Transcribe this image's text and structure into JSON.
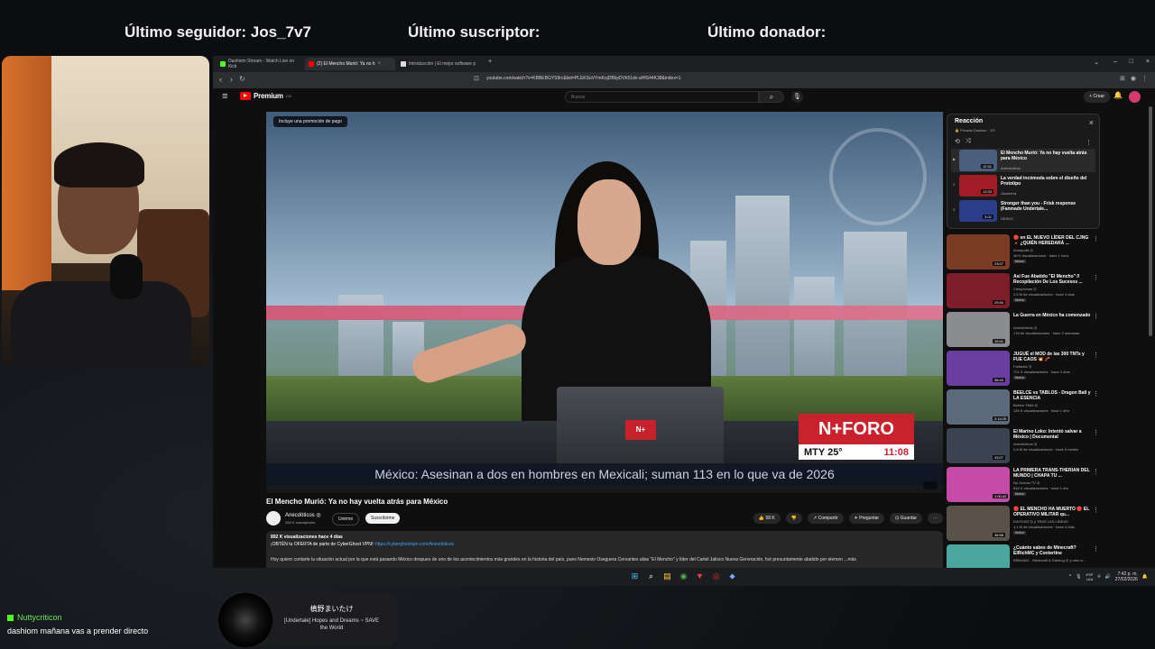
{
  "stream_bar": {
    "follower": "Último seguidor: Jos_7v7",
    "subscriber": "Último suscriptor:",
    "donor": "Último donador:"
  },
  "browser": {
    "tabs": [
      {
        "label": "Dashiom Stream - Watch Live on Kick",
        "active": false
      },
      {
        "label": "(2) El Mencho Murió: Ya no h",
        "active": true
      },
      {
        "label": "Introducción | El mejor software p",
        "active": false
      }
    ],
    "url": "youtube.com/watch?v=KBBEBGYS9rc&list=PLEKSoVYmKojDBbyDVk51dv-aHfS44K38&index=1"
  },
  "youtube": {
    "logo_text": "Premium",
    "logo_region": "CO",
    "search_placeholder": "Buscar",
    "create_label": "+ Crear",
    "video": {
      "promo_label": "Incluye una promoción de pago",
      "logo": "N+FORO",
      "city": "MTY 25°",
      "time": "11:08",
      "ticker": "México: Asesinan a dos en hombres en Mexicali; suman 113 en lo que va de 2026",
      "laptop_logo": "N+"
    },
    "title": "El Mencho Murió: Ya no hay vuelta atrás para México",
    "channel": {
      "name": "Anecdóticos ◎",
      "subs": "268 K suscriptores"
    },
    "join_label": "Unirme",
    "subscribe_label": "Suscribirme",
    "actions": [
      "👍 58 K",
      "👎",
      "↗ Compartir",
      "✦ Preguntar",
      "⊡ Guardar",
      "···"
    ],
    "description": {
      "stats": "892 K visualizaciones  hace 4 días",
      "promo_text": "¡OBTÉN tu OFERTA de parte de CyberGhost VPN!: ",
      "promo_link": "https://cyberghostvpn.com/Anecdoticos",
      "body": "Hoy quiero contarte la situación actual por la que está pasando México despues de uno de los acontecimientos más grandes en la historia del país, pues Nemesio Oseguera Cervantes alias \"El Mencho\" y líder del Cartel Jalisco Nueva Generación, fué presuntamente abatido por elemen  ...más"
    },
    "playlist": {
      "title": "Reacción",
      "subtitle": "🔒 Privada  Dashion · 1/3",
      "items": [
        {
          "num": "▶",
          "title": "El Mencho Murió: Ya no hay vuelta atrás para México",
          "channel": "Anecdóticos",
          "duration": "12:31",
          "color": "#4a5f80"
        },
        {
          "num": "2",
          "title": "La verdad incómoda sobre el diseño del Prototipo",
          "channel": "Vantoerra",
          "duration": "13:33",
          "color": "#a11c24"
        },
        {
          "num": "3",
          "title": "Stronger than you - Frisk response (Fanmade Undertale...",
          "channel": "DESKO",
          "duration": "3:02",
          "color": "#2a3c8a"
        }
      ]
    },
    "recommendations": [
      {
        "title": "🔴 en EL NUEVO LÍDER DEL CJNG 🔺 ¿QUIÉN HEREDARÁ ...",
        "channel": "Annapolis ◎",
        "views": "46 K visualizaciones · hace 1 hora",
        "badge": "Nuevo",
        "duration": "23:07",
        "color": "#7b3b24"
      },
      {
        "title": "Así Fue Abatido \"El Mencho\" // Recopilación De Los Sucesos ...",
        "channel": "Cienpochas ◎",
        "views": "2,5 M de visualizaciones · hace 4 días",
        "badge": "Nuevo",
        "duration": "29:40",
        "color": "#7e1c2a"
      },
      {
        "title": "La Guerra en México ha comenzado",
        "channel": "Anecdóticos ◎",
        "views": "1 M de visualizaciones · hace 2 semanas",
        "badge": "",
        "duration": "19:41",
        "color": "#8a8c90"
      },
      {
        "title": "JUGUÉ el MOD de las 300 TNTs y FUE CAOS 💥 🧨",
        "channel": "Farfadox ◎",
        "views": "721 K visualizaciones · hace 3 días",
        "badge": "Nuevo",
        "duration": "38:43",
        "color": "#6a3ea0"
      },
      {
        "title": "BEELCE vs TABLOS - Dragon Ball y LA ESENCIA",
        "channel": "Beelce Titleli ◎",
        "views": "126 K visualizaciones · hace 1 año",
        "badge": "",
        "duration": "2:14:25",
        "color": "#5d6a7c"
      },
      {
        "title": "El Marino Loko: Intentó salvar a México | Documental",
        "channel": "Anecdóticos ◎",
        "views": "2,8 M de visualizaciones · hace 5 meses",
        "badge": "",
        "duration": "43:07",
        "color": "#3b4351"
      },
      {
        "title": "LA PRIMERA TRANS-THERIAN DEL MUNDO | CHAPA TU ...",
        "channel": "No Somos TV ◎",
        "views": "816 K visualizaciones · hace 1 día",
        "badge": "Nuevo",
        "duration": "1:00:42",
        "color": "#c64aa8"
      },
      {
        "title": "🔴 EL MENCHO HA MUERTO 🔴 EL OPERATIVO MILITAR qu...",
        "channel": "DAYS423 ◎ y TRAS LAS LÍNEAS",
        "views": "1,1 M de visualizaciones · hace 4 días",
        "badge": "Nuevo",
        "duration": "36:58",
        "color": "#5a5148"
      },
      {
        "title": "¿Cuánto sabes de Minecraft? ElRichMC y Contertine",
        "channel": "ElRichMC - Minecraft & Gaming ◎ y otra m...",
        "views": "",
        "badge": "",
        "duration": "",
        "color": "#4aa7a0"
      }
    ]
  },
  "taskbar": {
    "lang_top": "ESP",
    "lang_bottom": "LAA",
    "time": "7:42 p. m.",
    "date": "27/02/2026"
  },
  "now_playing": {
    "artist": "槙野まいたけ",
    "song": "[Undertale] Hopes and Dreams ~ SAVE the World"
  },
  "chat": {
    "user": "Nuttycriticon",
    "message": "dashiom mañana vas a prender directo"
  }
}
